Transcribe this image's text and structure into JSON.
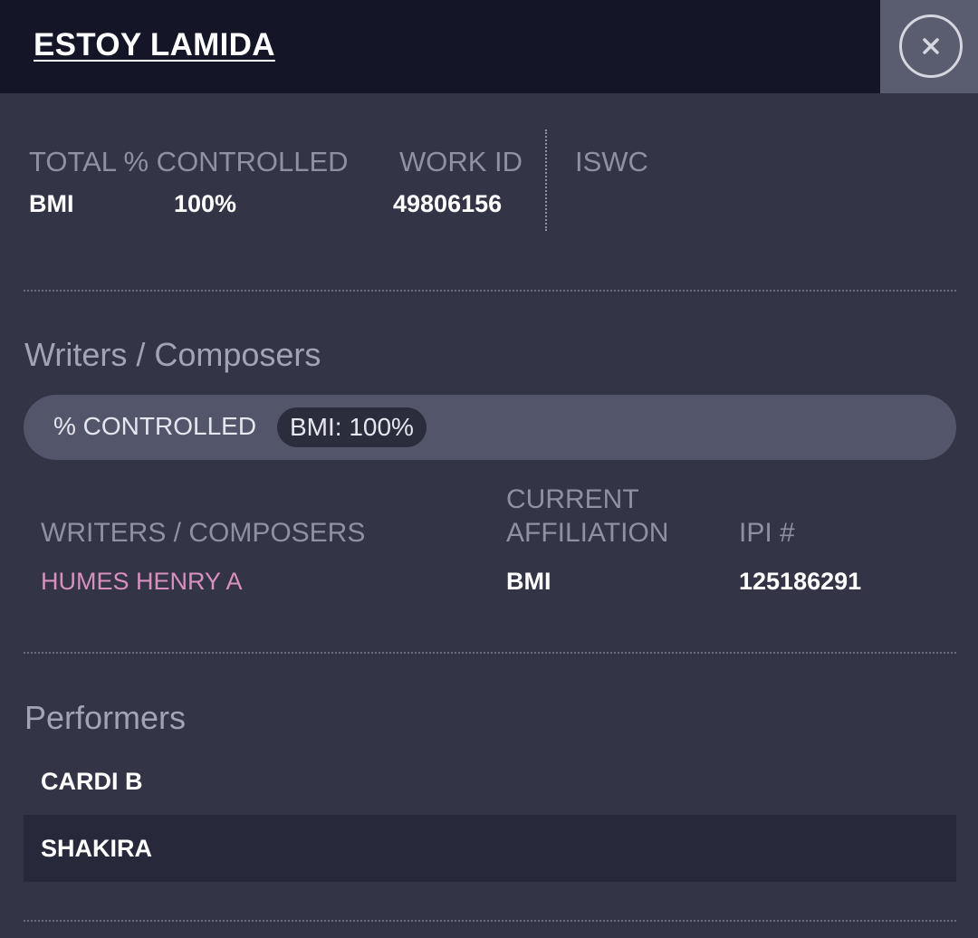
{
  "header": {
    "title": "ESTOY LAMIDA"
  },
  "summary": {
    "total_controlled_label": "TOTAL % CONTROLLED",
    "society": "BMI",
    "total_controlled_value": "100%",
    "work_id_label": "WORK ID",
    "work_id_value": "49806156",
    "iswc_label": "ISWC"
  },
  "writers_section": {
    "title": "Writers / Composers",
    "controlled_label": "% CONTROLLED",
    "controlled_chip": "BMI: 100%",
    "columns": {
      "writers": "WRITERS / COMPOSERS",
      "affiliation_line1": "CURRENT",
      "affiliation_line2": "AFFILIATION",
      "ipi": "IPI #"
    },
    "rows": [
      {
        "name": "HUMES HENRY A",
        "affiliation": "BMI",
        "ipi": "125186291"
      }
    ]
  },
  "performers_section": {
    "title": "Performers",
    "items": [
      "CARDI B",
      "SHAKIRA"
    ]
  },
  "colors": {
    "background": "#333446",
    "header": "#141628",
    "writer_link": "#d98fc0",
    "label": "#8e90a3"
  },
  "icons": {
    "close": "close-icon"
  }
}
